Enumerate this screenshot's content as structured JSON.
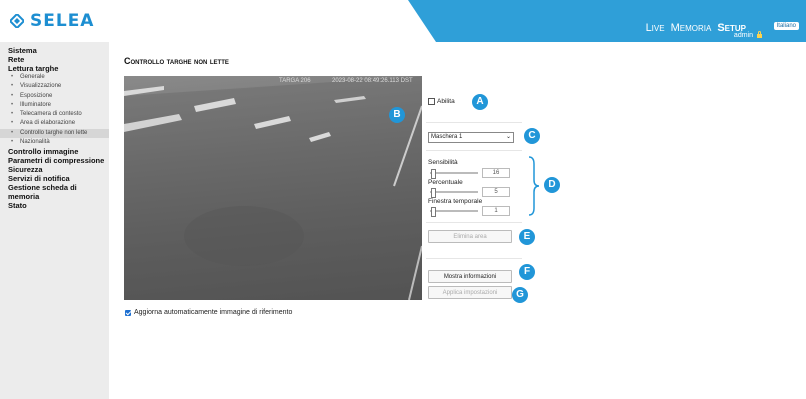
{
  "brand": {
    "name": "SELEA",
    "color": "#1d8ed1"
  },
  "topnav": {
    "items": [
      "Live",
      "Memoria",
      "Setup"
    ],
    "active": "Setup",
    "user": "admin",
    "language": "Italiano",
    "bar_color": "#2f9fd8"
  },
  "sidebar": {
    "sistema": "Sistema",
    "rete": "Rete",
    "lettura": "Lettura targhe",
    "lettura_items": [
      "Generale",
      "Visualizzazione",
      "Esposizione",
      "Illuminatore",
      "Telecamera di contesto",
      "Area di elaborazione",
      "Controllo targhe non lette",
      "Nazionalità"
    ],
    "active_item": "Controllo targhe non lette",
    "controllo_immagine": "Controllo immagine",
    "parametri": "Parametri di compressione",
    "sicurezza": "Sicurezza",
    "servizi": "Servizi di notifica",
    "gestione": "Gestione scheda di memoria",
    "stato": "Stato"
  },
  "page": {
    "title": "Controllo targhe non lette"
  },
  "camera": {
    "osd_left": "TARGA 206",
    "osd_right": "2023-08-22 08:49:26.113 DST"
  },
  "auto_ref": {
    "label": "Aggiorna automaticamente immagine di riferimento",
    "checked": true
  },
  "controls": {
    "enable_label": "Abilita",
    "enable_checked": false,
    "mask_select": "Maschera 1",
    "sensitivity": {
      "label": "Sensibilità",
      "value": "16"
    },
    "percentage": {
      "label": "Percentuale",
      "value": "5"
    },
    "time_window": {
      "label": "Finestra temporale",
      "value": "1"
    },
    "delete_area": "Elimina area",
    "show_info": "Mostra informazioni",
    "apply": "Applica impostazioni"
  },
  "callouts": [
    "A",
    "B",
    "C",
    "D",
    "E",
    "F",
    "G"
  ],
  "accent": "#2196d8"
}
